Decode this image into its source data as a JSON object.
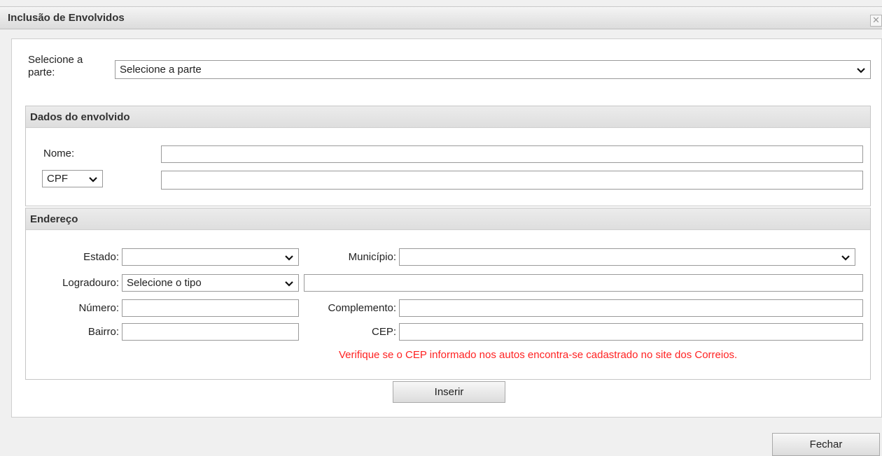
{
  "window": {
    "title": "Inclusão de Envolvidos",
    "close_glyph": "✕"
  },
  "parte": {
    "label_line1": "Selecione a",
    "label_line2": "parte:",
    "selected": "Selecione a parte"
  },
  "dados": {
    "header": "Dados do envolvido",
    "nome_label": "Nome:",
    "nome_value": "",
    "doc_type": "CPF",
    "doc_value": ""
  },
  "endereco": {
    "header": "Endereço",
    "estado_label": "Estado:",
    "estado_value": "",
    "municipio_label": "Município:",
    "municipio_value": "",
    "logradouro_label": "Logradouro:",
    "logradouro_type": "Selecione o tipo",
    "logradouro_value": "",
    "numero_label": "Número:",
    "numero_value": "",
    "complemento_label": "Complemento:",
    "complemento_value": "",
    "bairro_label": "Bairro:",
    "bairro_value": "",
    "cep_label": "CEP:",
    "cep_value": "",
    "warning": "Verifique se o CEP informado nos autos encontra-se cadastrado no site dos Correios."
  },
  "buttons": {
    "inserir": "Inserir",
    "fechar": "Fechar"
  },
  "colors": {
    "warning": "#ff2222"
  }
}
